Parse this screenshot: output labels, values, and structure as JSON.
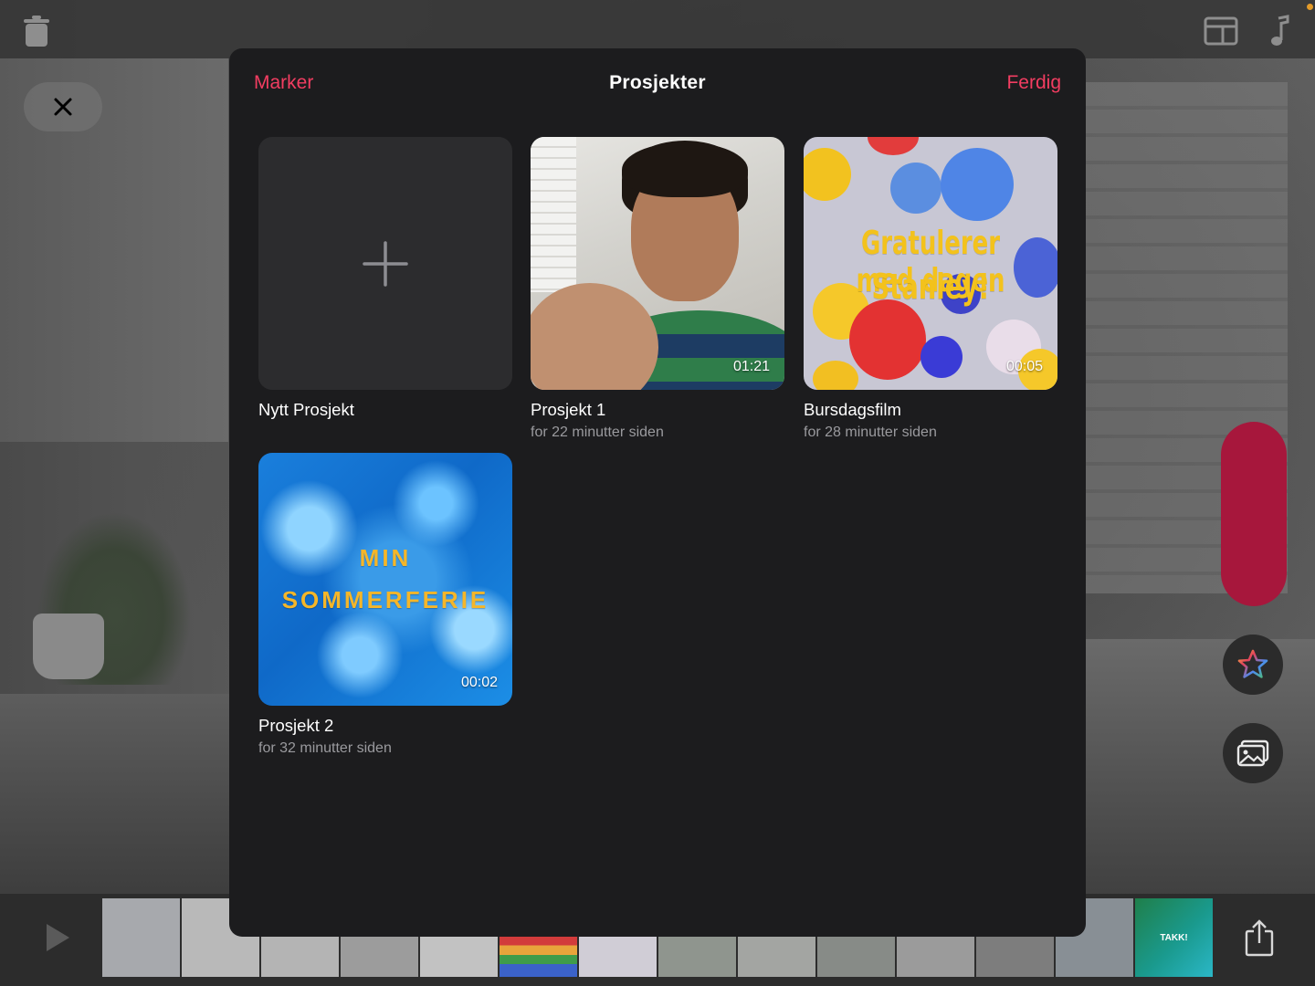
{
  "modal": {
    "title": "Prosjekter",
    "select_label": "Marker",
    "done_label": "Ferdig"
  },
  "projects": [
    {
      "name": "Nytt Prosjekt"
    },
    {
      "name": "Prosjekt 1",
      "date": "for 22 minutter siden",
      "duration": "01:21"
    },
    {
      "name": "Bursdagsfilm",
      "date": "for 28 minutter siden",
      "duration": "00:05",
      "thumb_text": [
        "Gratulerer med dagen",
        "Stanley!"
      ]
    },
    {
      "name": "Prosjekt 2",
      "date": "for 32 minutter siden",
      "duration": "00:02",
      "thumb_text": [
        "MIN",
        "SOMMERFERIE"
      ]
    }
  ],
  "timeline": {
    "end_frame_text": "TAKK!"
  },
  "colors": {
    "accent": "#f23d61",
    "modal_bg": "#1c1c1e",
    "record": "#a7173c"
  },
  "icons": [
    "trash-icon",
    "layout-icon",
    "music-icon",
    "close-icon",
    "plus-icon",
    "star-icon",
    "photos-icon",
    "play-icon",
    "share-icon"
  ]
}
